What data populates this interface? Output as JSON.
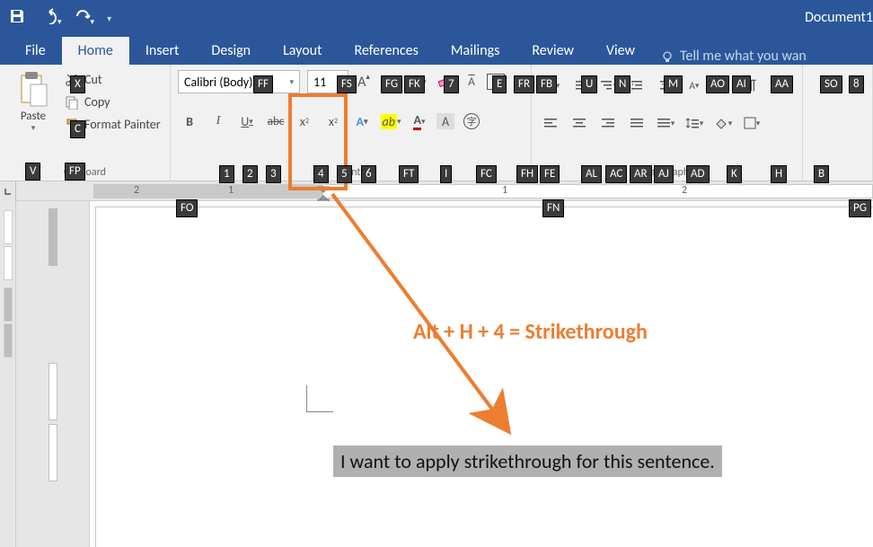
{
  "title": "Document1",
  "tabs": {
    "file": "File",
    "home": "Home",
    "insert": "Insert",
    "design": "Design",
    "layout": "Layout",
    "references": "References",
    "mailings": "Mailings",
    "review": "Review",
    "view": "View"
  },
  "tellme": "Tell me what you wan",
  "clipboard": {
    "paste": "Paste",
    "cut": "Cut",
    "copy": "Copy",
    "format_painter": "Format Painter",
    "label": "Clipboard"
  },
  "font": {
    "name": "Calibri (Body)",
    "size": "11",
    "label": "Font"
  },
  "paragraph": {
    "label": "Paragraph"
  },
  "ruler": {
    "n1": "1",
    "n2": "2",
    "n3": "1",
    "n4": "2"
  },
  "keytips": {
    "V": "V",
    "X": "X",
    "C": "C",
    "FP": "FP",
    "FF": "FF",
    "FS": "FS",
    "FG": "FG",
    "FK": "FK",
    "k7": "7",
    "E": "E",
    "FR": "FR",
    "FB": "FB",
    "U": "U",
    "N": "N",
    "M": "M",
    "AO": "AO",
    "AI": "AI",
    "AA": "AA",
    "SO": "SO",
    "k8": "8",
    "k1": "1",
    "k2": "2",
    "k3": "3",
    "k4": "4",
    "k5": "5",
    "k6": "6",
    "FT": "FT",
    "I": "I",
    "FC": "FC",
    "FH": "FH",
    "FE": "FE",
    "AL": "AL",
    "AC": "AC",
    "AR": "AR",
    "AJ": "AJ",
    "AD": "AD",
    "K": "K",
    "H": "H",
    "B": "B",
    "FO": "FO",
    "FN": "FN",
    "PG": "PG"
  },
  "callout": "Alt + H + 4 = Strikethrough",
  "sentence": "I want to apply strikethrough for this sentence."
}
